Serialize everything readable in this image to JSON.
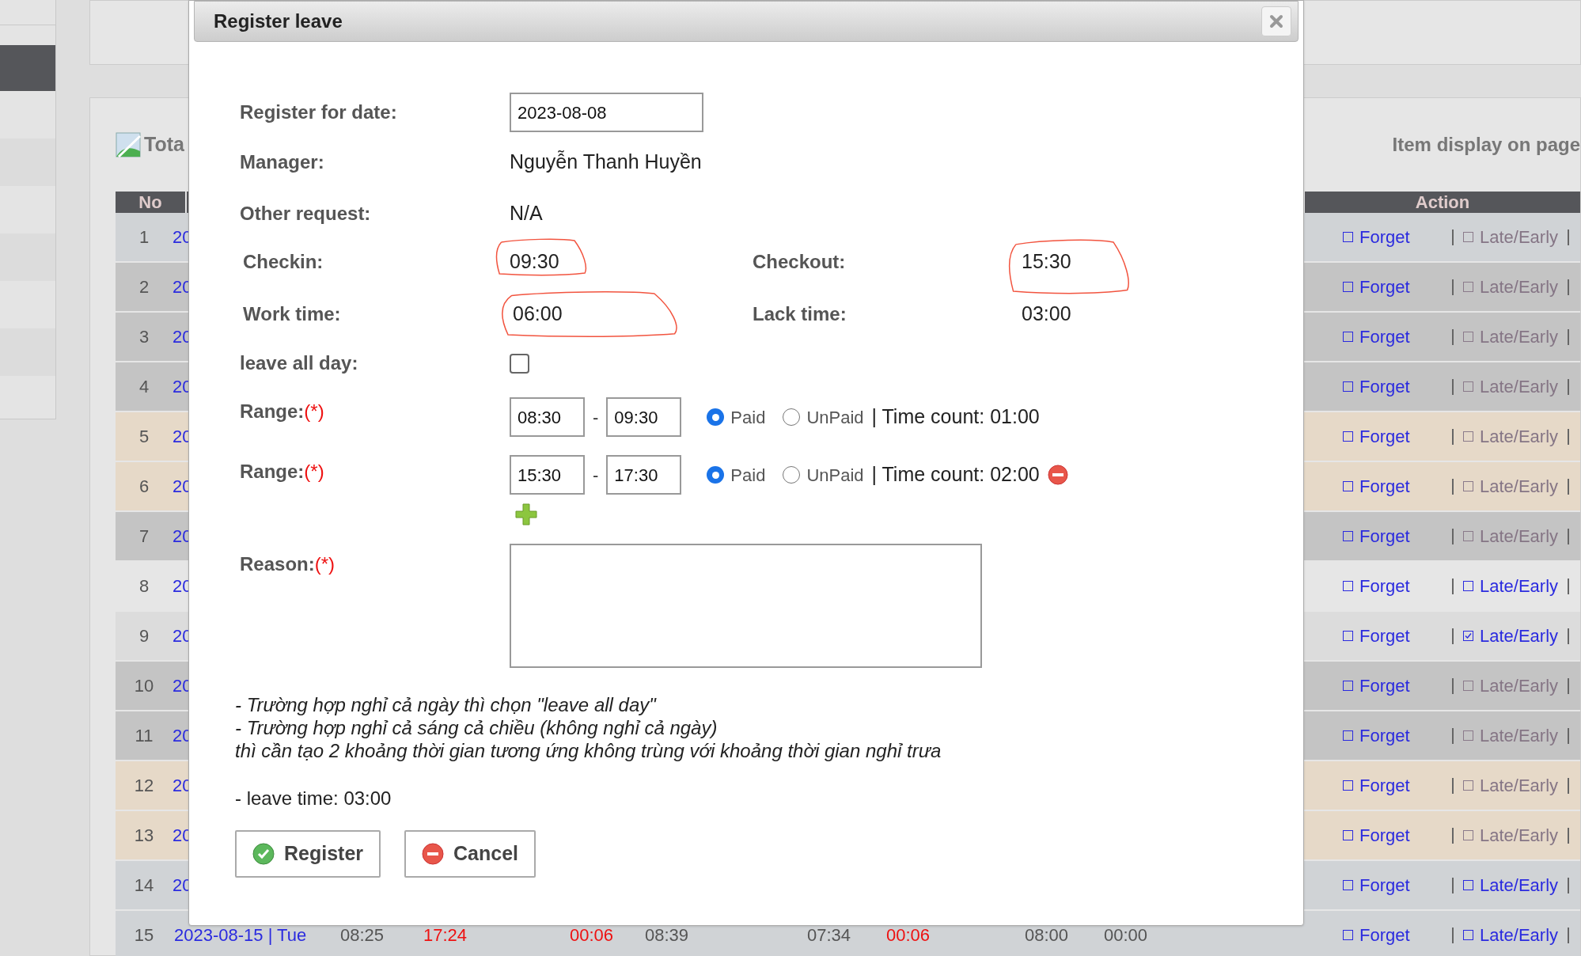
{
  "background": {
    "summary_label": "Tota",
    "page_size_label": "Item display on page",
    "table": {
      "columns": [
        "No",
        "Action"
      ],
      "rows": [
        {
          "no": "1",
          "date": "20",
          "color": "#d0d3d6",
          "forget": {
            "label": "Forget",
            "checked": false
          },
          "late_early": {
            "label": "Late/Early",
            "checked": false,
            "disabled": true
          }
        },
        {
          "no": "2",
          "date": "20",
          "color": "#c4c4c4",
          "forget": {
            "label": "Forget",
            "checked": false
          },
          "late_early": {
            "label": "Late/Early",
            "checked": false,
            "disabled": true
          }
        },
        {
          "no": "3",
          "date": "20",
          "color": "#c4c4c4",
          "forget": {
            "label": "Forget",
            "checked": false
          },
          "late_early": {
            "label": "Late/Early",
            "checked": false,
            "disabled": true
          }
        },
        {
          "no": "4",
          "date": "20",
          "color": "#c4c4c4",
          "forget": {
            "label": "Forget",
            "checked": false
          },
          "late_early": {
            "label": "Late/Early",
            "checked": false,
            "disabled": true
          }
        },
        {
          "no": "5",
          "date": "20",
          "color": "#e6d9c8",
          "forget": {
            "label": "Forget",
            "checked": false
          },
          "late_early": {
            "label": "Late/Early",
            "checked": false,
            "disabled": true
          }
        },
        {
          "no": "6",
          "date": "20",
          "color": "#e6d9c8",
          "forget": {
            "label": "Forget",
            "checked": false
          },
          "late_early": {
            "label": "Late/Early",
            "checked": false,
            "disabled": true
          }
        },
        {
          "no": "7",
          "date": "20",
          "color": "#c4c4c4",
          "forget": {
            "label": "Forget",
            "checked": false
          },
          "late_early": {
            "label": "Late/Early",
            "checked": false,
            "disabled": true
          }
        },
        {
          "no": "8",
          "date": "20",
          "color": "#e6e6e6",
          "forget": {
            "label": "Forget",
            "checked": false
          },
          "late_early": {
            "label": "Late/Early",
            "checked": false,
            "disabled": false
          }
        },
        {
          "no": "9",
          "date": "20",
          "color": "#dcdcdc",
          "forget": {
            "label": "Forget",
            "checked": false
          },
          "late_early": {
            "label": "Late/Early",
            "checked": true,
            "disabled": false
          }
        },
        {
          "no": "10",
          "date": "20",
          "color": "#c4c4c4",
          "forget": {
            "label": "Forget",
            "checked": false
          },
          "late_early": {
            "label": "Late/Early",
            "checked": false,
            "disabled": true
          }
        },
        {
          "no": "11",
          "date": "20",
          "color": "#c4c4c4",
          "forget": {
            "label": "Forget",
            "checked": false
          },
          "late_early": {
            "label": "Late/Early",
            "checked": false,
            "disabled": true
          }
        },
        {
          "no": "12",
          "date": "20",
          "color": "#e6d9c8",
          "forget": {
            "label": "Forget",
            "checked": false
          },
          "late_early": {
            "label": "Late/Early",
            "checked": false,
            "disabled": true
          }
        },
        {
          "no": "13",
          "date": "20",
          "color": "#e6d9c8",
          "forget": {
            "label": "Forget",
            "checked": false
          },
          "late_early": {
            "label": "Late/Early",
            "checked": false,
            "disabled": true
          }
        },
        {
          "no": "14",
          "date": "20",
          "color": "#d0d3d6",
          "forget": {
            "label": "Forget",
            "checked": false
          },
          "late_early": {
            "label": "Late/Early",
            "checked": false,
            "disabled": false
          }
        },
        {
          "no": "15",
          "date": "2023-08-15 | Tue",
          "color": "#d0d3d6",
          "cells": [
            {
              "text": "08:25",
              "alert": false
            },
            {
              "text": "17:24",
              "alert": true
            },
            {
              "text": "00:06",
              "alert": true
            },
            {
              "text": "08:39",
              "alert": false
            },
            {
              "text": "07:34",
              "alert": false
            },
            {
              "text": "00:06",
              "alert": true
            },
            {
              "text": "08:00",
              "alert": false
            },
            {
              "text": "00:00",
              "alert": false
            }
          ],
          "forget": {
            "label": "Forget",
            "checked": false
          },
          "late_early": {
            "label": "Late/Early",
            "checked": false,
            "disabled": false
          }
        }
      ]
    }
  },
  "dialog": {
    "title": "Register leave",
    "date": {
      "label": "Register for date:",
      "value": "2023-08-08"
    },
    "manager": {
      "label": "Manager:",
      "value": "Nguyễn Thanh Huyền"
    },
    "other_request": {
      "label": "Other request:",
      "value": "N/A"
    },
    "checkin": {
      "label": "Checkin:",
      "value": "09:30",
      "circled": true
    },
    "checkout": {
      "label": "Checkout:",
      "value": "15:30",
      "circled": true
    },
    "work_time": {
      "label": "Work time:",
      "value": "06:00",
      "circled": true
    },
    "lack_time": {
      "label": "Lack time:",
      "value": "03:00",
      "circled": false
    },
    "leave_all_day": {
      "label": "leave all day:",
      "checked": false
    },
    "ranges": [
      {
        "label": "Range:",
        "required_mark": "(*)",
        "from": "08:30",
        "separator": "-",
        "to": "09:30",
        "options": [
          {
            "label": "Paid",
            "selected": true
          },
          {
            "label": "UnPaid",
            "selected": false
          }
        ],
        "time_count": "| Time count: 01:00",
        "removable": false
      },
      {
        "label": "Range:",
        "required_mark": "(*)",
        "from": "15:30",
        "separator": "-",
        "to": "17:30",
        "options": [
          {
            "label": "Paid",
            "selected": true
          },
          {
            "label": "UnPaid",
            "selected": false
          }
        ],
        "time_count": "| Time count: 02:00",
        "removable": true
      }
    ],
    "reason": {
      "label": "Reason:",
      "required_mark": "(*)"
    },
    "notes": [
      "- Trường hợp nghỉ cả ngày thì chọn \"leave all day\"",
      "- Trường hợp nghỉ cả sáng cả chiều (không nghỉ cả ngày)",
      "thì cần tạo 2 khoảng thời gian tương ứng không trùng với khoảng thời gian nghỉ trưa"
    ],
    "leave_time": "- leave time: 03:00",
    "buttons": [
      {
        "label": "Register",
        "kind": "confirm"
      },
      {
        "label": "Cancel",
        "kind": "cancel"
      }
    ]
  }
}
